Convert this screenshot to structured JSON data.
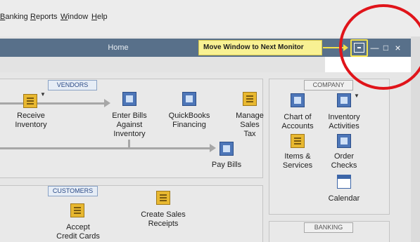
{
  "menubar": {
    "items": [
      {
        "name": "banking",
        "first": "B",
        "rest": "anking"
      },
      {
        "name": "reports",
        "first": "R",
        "rest": "eports"
      },
      {
        "name": "window",
        "first": "W",
        "rest": "indow"
      },
      {
        "name": "help",
        "first": "H",
        "rest": "elp"
      }
    ]
  },
  "window": {
    "title": "Home",
    "tooltip": "Move Window to Next Monitor button",
    "min_glyph": "—",
    "max_glyph": "□",
    "close_glyph": "×"
  },
  "vendors": {
    "tab": "VENDORS",
    "receive_inventory": "Receive\nInventory",
    "enter_bills": "Enter Bills\nAgainst\nInventory",
    "quickbooks_financing": "QuickBooks\nFinancing",
    "manage_sales_tax": "Manage\nSales\nTax",
    "pay_bills": "Pay Bills"
  },
  "customers": {
    "tab": "CUSTOMERS",
    "accept_credit_cards": "Accept\nCredit Cards",
    "create_sales_receipts": "Create Sales\nReceipts"
  },
  "company": {
    "tab": "COMPANY",
    "chart_of_accounts": "Chart of\nAccounts",
    "inventory_activities": "Inventory\nActivities",
    "items_services": "Items &\nServices",
    "order_checks": "Order\nChecks",
    "calendar": "Calendar"
  },
  "banking": {
    "tab": "BANKING"
  },
  "colors": {
    "titlebar": "#58708a",
    "tooltip_bg": "#f8f193",
    "highlight_circle": "#e0141a"
  }
}
